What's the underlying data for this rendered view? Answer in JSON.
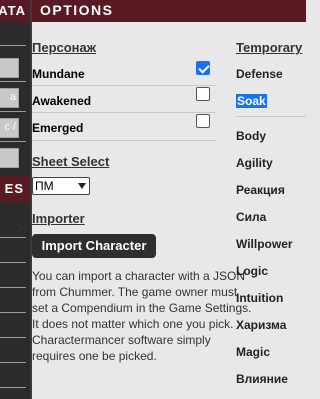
{
  "left_panel": {
    "top_tab": "ATA",
    "buttons": [
      "",
      "a",
      "c /",
      ""
    ],
    "bottom_bar": "ES"
  },
  "header": {
    "title": "OPTIONS"
  },
  "persona": {
    "heading": "Персонаж",
    "rows": [
      {
        "label": "Mundane",
        "checked": true
      },
      {
        "label": "Awakened",
        "checked": false
      },
      {
        "label": "Emerged",
        "checked": false
      }
    ]
  },
  "sheet_select": {
    "heading": "Sheet Select",
    "selected": "ПМ"
  },
  "importer": {
    "heading": "Importer",
    "tools_icon": "tools-icon",
    "button_label": "Import Character",
    "description": "You can import a character with a JSON from Chummer. The game owner must set a Compendium in the Game Settings. It does not matter which one you pick. Charactermancer software simply requires one be picked."
  },
  "temporary": {
    "heading": "Temporary",
    "items": [
      "Defense",
      "Soak"
    ]
  },
  "attributes": [
    "Body",
    "Agility",
    "Реакция",
    "Сила",
    "Willpower",
    "Logic",
    "Intuition",
    "Харизма",
    "Magic",
    "Влияние"
  ],
  "colors": {
    "accent": "#5a1a22",
    "checkbox": "#1a73e8",
    "highlight": "#1a73e8"
  }
}
